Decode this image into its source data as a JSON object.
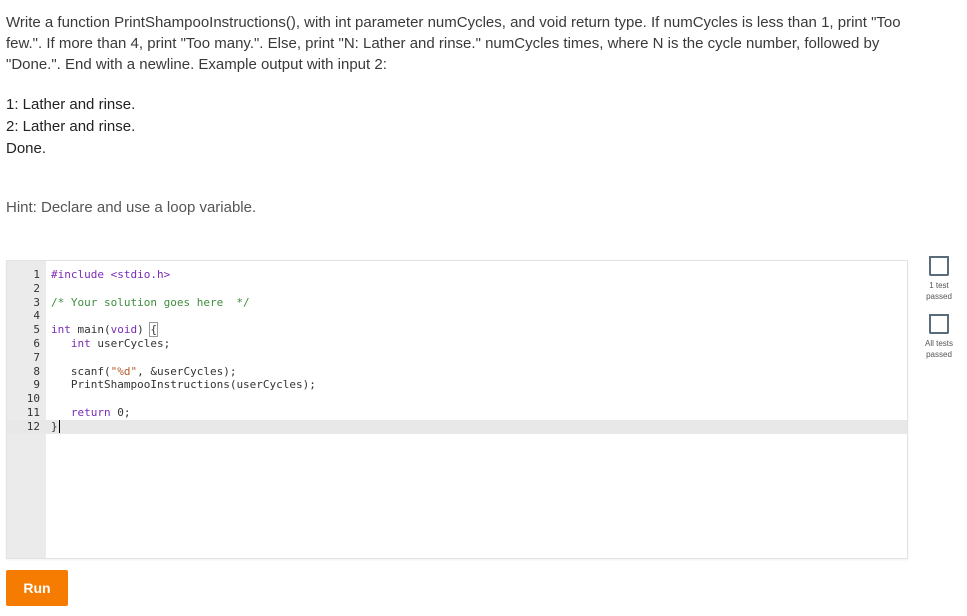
{
  "prompt": {
    "text": "Write a function PrintShampooInstructions(), with int parameter numCycles, and void return type. If numCycles is less than 1, print \"Too few.\". If more than 4, print \"Too many.\". Else, print \"N: Lather and rinse.\" numCycles times, where N is the cycle number, followed by \"Done.\". End with a newline. Example output with input 2:"
  },
  "example_output": {
    "lines": [
      "1: Lather and rinse.",
      "2: Lather and rinse.",
      "Done."
    ]
  },
  "hint": "Hint: Declare and use a loop variable.",
  "editor": {
    "line_numbers": [
      "1",
      "2",
      "3",
      "4",
      "5",
      "6",
      "7",
      "8",
      "9",
      "10",
      "11",
      "12"
    ],
    "active_line": 12
  },
  "run_button": {
    "label": "Run"
  },
  "tests": [
    {
      "label": "1 test passed",
      "line1": "1 test",
      "line2": "passed",
      "icon": "checkbox-icon"
    },
    {
      "label": "All tests passed",
      "line1": "All tests",
      "line2": "passed",
      "icon": "checkbox-icon"
    }
  ],
  "code": {
    "l1": "#include <stdio.h>",
    "l3_comment": "/* Your solution goes here  */",
    "l5_kw1": "int",
    "l5_rest": " main(",
    "l5_kw2": "void",
    "l5_end": ") ",
    "l5_brace": "{",
    "l6_kw": "int",
    "l6_rest": " userCycles;",
    "l8_a": "scanf(",
    "l8_str": "\"%d\"",
    "l8_b": ", &userCycles);",
    "l9": "PrintShampooInstructions(userCycles);",
    "l11_kw": "return",
    "l11_rest": " 0;",
    "l12": "}"
  }
}
